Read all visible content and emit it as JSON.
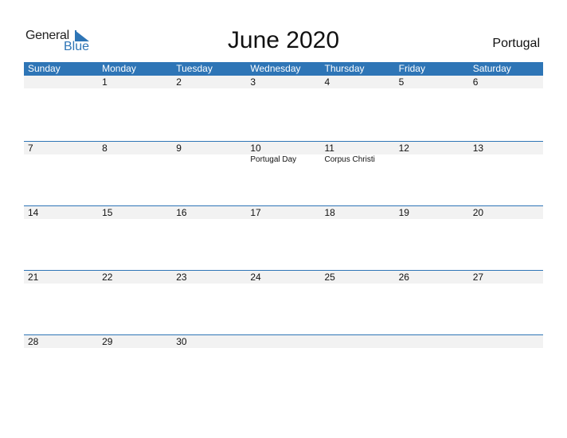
{
  "logo": {
    "text_general": "General",
    "text_blue": "Blue"
  },
  "title": "June 2020",
  "country": "Portugal",
  "weekdays": [
    "Sunday",
    "Monday",
    "Tuesday",
    "Wednesday",
    "Thursday",
    "Friday",
    "Saturday"
  ],
  "weeks": [
    {
      "days": [
        "",
        "1",
        "2",
        "3",
        "4",
        "5",
        "6"
      ],
      "events": [
        "",
        "",
        "",
        "",
        "",
        "",
        ""
      ]
    },
    {
      "days": [
        "7",
        "8",
        "9",
        "10",
        "11",
        "12",
        "13"
      ],
      "events": [
        "",
        "",
        "",
        "Portugal Day",
        "Corpus Christi",
        "",
        ""
      ]
    },
    {
      "days": [
        "14",
        "15",
        "16",
        "17",
        "18",
        "19",
        "20"
      ],
      "events": [
        "",
        "",
        "",
        "",
        "",
        "",
        ""
      ]
    },
    {
      "days": [
        "21",
        "22",
        "23",
        "24",
        "25",
        "26",
        "27"
      ],
      "events": [
        "",
        "",
        "",
        "",
        "",
        "",
        ""
      ]
    },
    {
      "days": [
        "28",
        "29",
        "30",
        "",
        "",
        "",
        ""
      ],
      "events": [
        "",
        "",
        "",
        "",
        "",
        "",
        ""
      ]
    }
  ],
  "colors": {
    "accent": "#2e75b6",
    "row_bg": "#f2f2f2"
  }
}
